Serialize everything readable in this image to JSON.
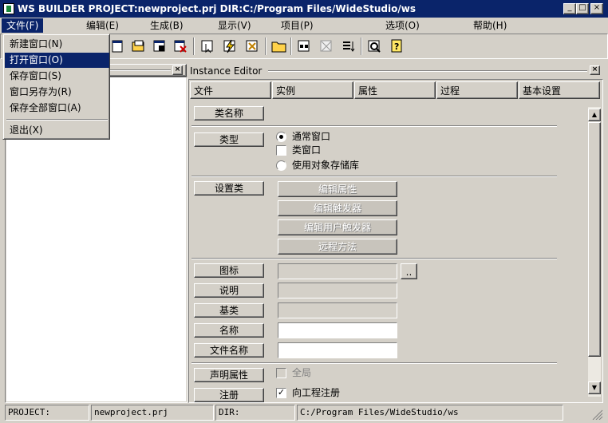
{
  "window": {
    "title": "WS BUILDER PROJECT:newproject.prj DIR:C:/Program Files/WideStudio/ws",
    "minimize": "_",
    "maximize": "□",
    "close": "×"
  },
  "menubar": [
    {
      "label": "文件(F)"
    },
    {
      "label": "编辑(E)"
    },
    {
      "label": "生成(B)"
    },
    {
      "label": "显示(V)"
    },
    {
      "label": "项目(P)"
    },
    {
      "label": "选项(O)"
    },
    {
      "label": "帮助(H)"
    }
  ],
  "file_menu": {
    "items": [
      {
        "label": "新建窗口(N)"
      },
      {
        "label": "打开窗口(O)"
      },
      {
        "label": "保存窗口(S)"
      },
      {
        "label": "窗口另存为(R)"
      },
      {
        "label": "保存全部窗口(A)"
      },
      {
        "label": "退出(X)"
      }
    ]
  },
  "toolbar": {
    "icons": [
      "new-window-icon",
      "open-window-icon",
      "save-window-icon",
      "close-window-icon",
      "select-icon",
      "build-icon",
      "run-icon",
      "open-folder-icon",
      "grid-icon",
      "delete-icon",
      "list-icon",
      "preview-icon",
      "help-icon"
    ]
  },
  "panel_close": "×",
  "instance_editor": {
    "title": "Instance Editor",
    "close": "×",
    "tabs": [
      {
        "label": "文件"
      },
      {
        "label": "实例"
      },
      {
        "label": "属性"
      },
      {
        "label": "过程"
      },
      {
        "label": "基本设置"
      }
    ],
    "fields": {
      "class_name": "类名称",
      "type": "类型",
      "type_options": [
        {
          "label": "通常窗口",
          "selected": true
        },
        {
          "label": "类窗口",
          "checked": false
        },
        {
          "label": "使用对象存储库",
          "selected": false
        }
      ],
      "settings_class": "设置类",
      "settings_buttons": [
        {
          "label": "编辑属性"
        },
        {
          "label": "编辑触发器"
        },
        {
          "label": "编辑用户触发器"
        },
        {
          "label": "远程方法"
        }
      ],
      "icon": "图标",
      "icon_browse": "..",
      "description": "说明",
      "base_class": "基类",
      "name": "名称",
      "file_name": "文件名称",
      "declare_attr": "声明属性",
      "global": "全局",
      "global_checked": false,
      "register": "注册",
      "register_to_project": "向工程注册",
      "register_checked": true
    }
  },
  "statusbar": {
    "project_label": "PROJECT:",
    "project_value": "newproject.prj",
    "dir_label": "DIR:",
    "dir_value": "C:/Program Files/WideStudio/ws"
  }
}
